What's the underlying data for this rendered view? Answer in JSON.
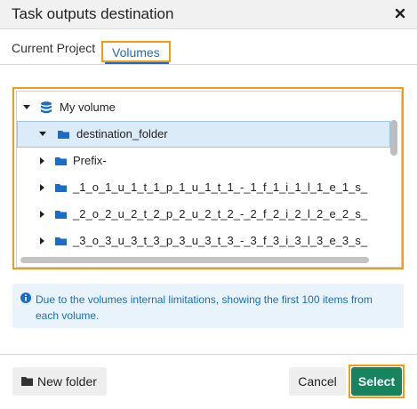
{
  "dialog": {
    "title": "Task outputs destination"
  },
  "tabs": [
    {
      "label": "Current Project",
      "active": false
    },
    {
      "label": "Volumes",
      "active": true
    }
  ],
  "tree": {
    "items": [
      {
        "label": "My volume",
        "icon": "database-icon",
        "expanded": true,
        "selected": false
      },
      {
        "label": "destination_folder",
        "icon": "folder-icon",
        "expanded": true,
        "selected": true
      },
      {
        "label": "Prefix-",
        "icon": "folder-icon",
        "expanded": false,
        "selected": false
      },
      {
        "label": "_1_o_1_u_1_t_1_p_1_u_1_t_1_-_1_f_1_i_1_l_1_e_1_s_",
        "icon": "folder-icon",
        "expanded": false,
        "selected": false
      },
      {
        "label": "_2_o_2_u_2_t_2_p_2_u_2_t_2_-_2_f_2_i_2_l_2_e_2_s_",
        "icon": "folder-icon",
        "expanded": false,
        "selected": false
      },
      {
        "label": "_3_o_3_u_3_t_3_p_3_u_3_t_3_-_3_f_3_i_3_l_3_e_3_s_",
        "icon": "folder-icon",
        "expanded": false,
        "selected": false
      }
    ]
  },
  "info": {
    "text": "Due to the volumes internal limitations, showing the first 100 items from each volume."
  },
  "footer": {
    "new_folder_label": "New folder",
    "cancel_label": "Cancel",
    "select_label": "Select"
  },
  "colors": {
    "accent": "#1a6dc6",
    "highlight_outline": "#f39c12",
    "primary_button": "#17845f",
    "selected_row": "#dcebf8",
    "info_background": "#e8f3fb"
  }
}
